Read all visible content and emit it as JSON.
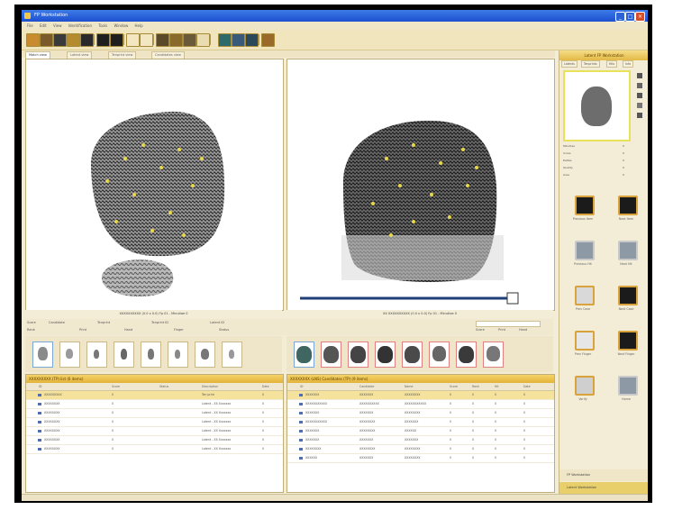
{
  "window": {
    "title": "FP Workstation"
  },
  "menubar": {
    "items": [
      "File",
      "Edit",
      "View",
      "Identification",
      "Tools",
      "Window",
      "Help"
    ]
  },
  "toolbar": {
    "buttons": [
      "open-icon",
      "save-icon",
      "print-icon",
      "scan-icon",
      "back-icon",
      "forward-icon",
      "zoom-in-icon",
      "zoom-out-icon",
      "rotate-left-icon",
      "rotate-right-icon",
      "minutiae-icon",
      "enhance-icon",
      "color-icon",
      "gray-icon",
      "filter-icon",
      "compare-icon"
    ]
  },
  "tabs": [
    "Match view",
    "Latent view",
    "Tenprint view",
    "Candidates view"
  ],
  "panes": {
    "left_caption": "XXXXXXXXXX (0.0 x 0.0) Fp 01 - Minutiae 0",
    "right_caption": "XX XXXXXXXXXX (0.0 x 0.0) Fp 01 - Minutiae 0"
  },
  "controls": {
    "row1": [
      "Score",
      "Candidate",
      "Tenprint",
      "Tenprint ID",
      "Latent ID"
    ],
    "row2": [
      "Rank",
      "Print",
      "Hand",
      "Finger",
      "Status"
    ],
    "right": [
      "Score",
      "Print",
      "Hand"
    ]
  },
  "lists": {
    "left": {
      "title": "XXXXXXXXX (TP) list (6 items)",
      "columns": [
        "ID",
        "Score",
        "Status",
        "Description",
        "Date"
      ],
      "rows": [
        {
          "id": "XXXXXXXXX",
          "score": "0",
          "status": "",
          "desc": "Ten print",
          "date": "0"
        },
        {
          "id": "XXXXXXXX",
          "score": "0",
          "status": "",
          "desc": "Latent - XX Xxxxxxx",
          "date": "0"
        },
        {
          "id": "XXXXXXXX",
          "score": "0",
          "status": "",
          "desc": "Latent - XX Xxxxxxx",
          "date": "0"
        },
        {
          "id": "XXXXXXXX",
          "score": "0",
          "status": "",
          "desc": "Latent - XX Xxxxxxx",
          "date": "0"
        },
        {
          "id": "XXXXXXXX",
          "score": "0",
          "status": "",
          "desc": "Latent - XX Xxxxxxx",
          "date": "0"
        },
        {
          "id": "XXXXXXXX",
          "score": "0",
          "status": "",
          "desc": "Latent - XX Xxxxxxx",
          "date": "0"
        },
        {
          "id": "XXXXXXXX",
          "score": "0",
          "status": "",
          "desc": "Latent - XX Xxxxxxx",
          "date": "0"
        }
      ]
    },
    "right": {
      "title": "XXXXXXXX (LNS) Candidates (TP) (9 items)",
      "columns": [
        "ID",
        "Candidate",
        "Name",
        "Score",
        "Rank",
        "Hit",
        "Date"
      ],
      "rows": [
        {
          "id": "XXXXXXX",
          "cand": "XXXXXXX",
          "name": "XXXXXXXX",
          "score": "0",
          "rank": "0",
          "hit": "0",
          "date": "0"
        },
        {
          "id": "XXXXXXXXXXX",
          "cand": "XXXXXXXXXX",
          "name": "XXXXXXXXXXX",
          "score": "0",
          "rank": "0",
          "hit": "0",
          "date": "0"
        },
        {
          "id": "XXXXXXX",
          "cand": "XXXXXXX",
          "name": "XXXXXXXX",
          "score": "0",
          "rank": "0",
          "hit": "0",
          "date": "0"
        },
        {
          "id": "XXXXXXXXXXX",
          "cand": "XXXXXXXX",
          "name": "XXXXXXX",
          "score": "0",
          "rank": "0",
          "hit": "0",
          "date": "0"
        },
        {
          "id": "XXXXXXX",
          "cand": "XXXXXXXX",
          "name": "XXXXXX",
          "score": "0",
          "rank": "0",
          "hit": "0",
          "date": "0"
        },
        {
          "id": "XXXXXXX",
          "cand": "XXXXXXX",
          "name": "XXXXXXX",
          "score": "0",
          "rank": "0",
          "hit": "0",
          "date": "0"
        },
        {
          "id": "XXXXXXXX",
          "cand": "XXXXXXXX",
          "name": "XXXXXXXX",
          "score": "0",
          "rank": "0",
          "hit": "0",
          "date": "0"
        },
        {
          "id": "XXXXXX",
          "cand": "XXXXXXX",
          "name": "XXXXXXXX",
          "score": "0",
          "rank": "0",
          "hit": "0",
          "date": "0"
        }
      ]
    }
  },
  "sidebar": {
    "title": "Latent FP Workstation",
    "tabs": [
      "Latents",
      "Tenprints",
      "Hits",
      "Info"
    ],
    "stats": [
      {
        "label": "Minutiae",
        "value": "0"
      },
      {
        "label": "Cores",
        "value": "0"
      },
      {
        "label": "Deltas",
        "value": "0"
      },
      {
        "label": "Quality",
        "value": "0"
      },
      {
        "label": "Area",
        "value": "0"
      }
    ],
    "nav": [
      {
        "label": "Previous Item",
        "icon": "arrow-left-icon"
      },
      {
        "label": "Next Item",
        "icon": "arrow-right-icon"
      },
      {
        "label": "Previous Hit",
        "icon": "hand-back-icon"
      },
      {
        "label": "Next Hit",
        "icon": "hand-forward-icon"
      },
      {
        "label": "Prev Case",
        "icon": "case-prev-icon"
      },
      {
        "label": "Next Case",
        "icon": "case-next-icon"
      },
      {
        "label": "Prev Finger",
        "icon": "finger-prev-icon"
      },
      {
        "label": "Next Finger",
        "icon": "finger-next-icon"
      },
      {
        "label": "Verify",
        "icon": "verify-icon"
      },
      {
        "label": "Home",
        "icon": "home-icon"
      }
    ],
    "bottom": [
      "FP Workstation",
      "Latent Workstation"
    ]
  },
  "colors": {
    "accent": "#e2b944",
    "titlebar": "#1c4fcf",
    "highlight": "#f5e29c"
  }
}
